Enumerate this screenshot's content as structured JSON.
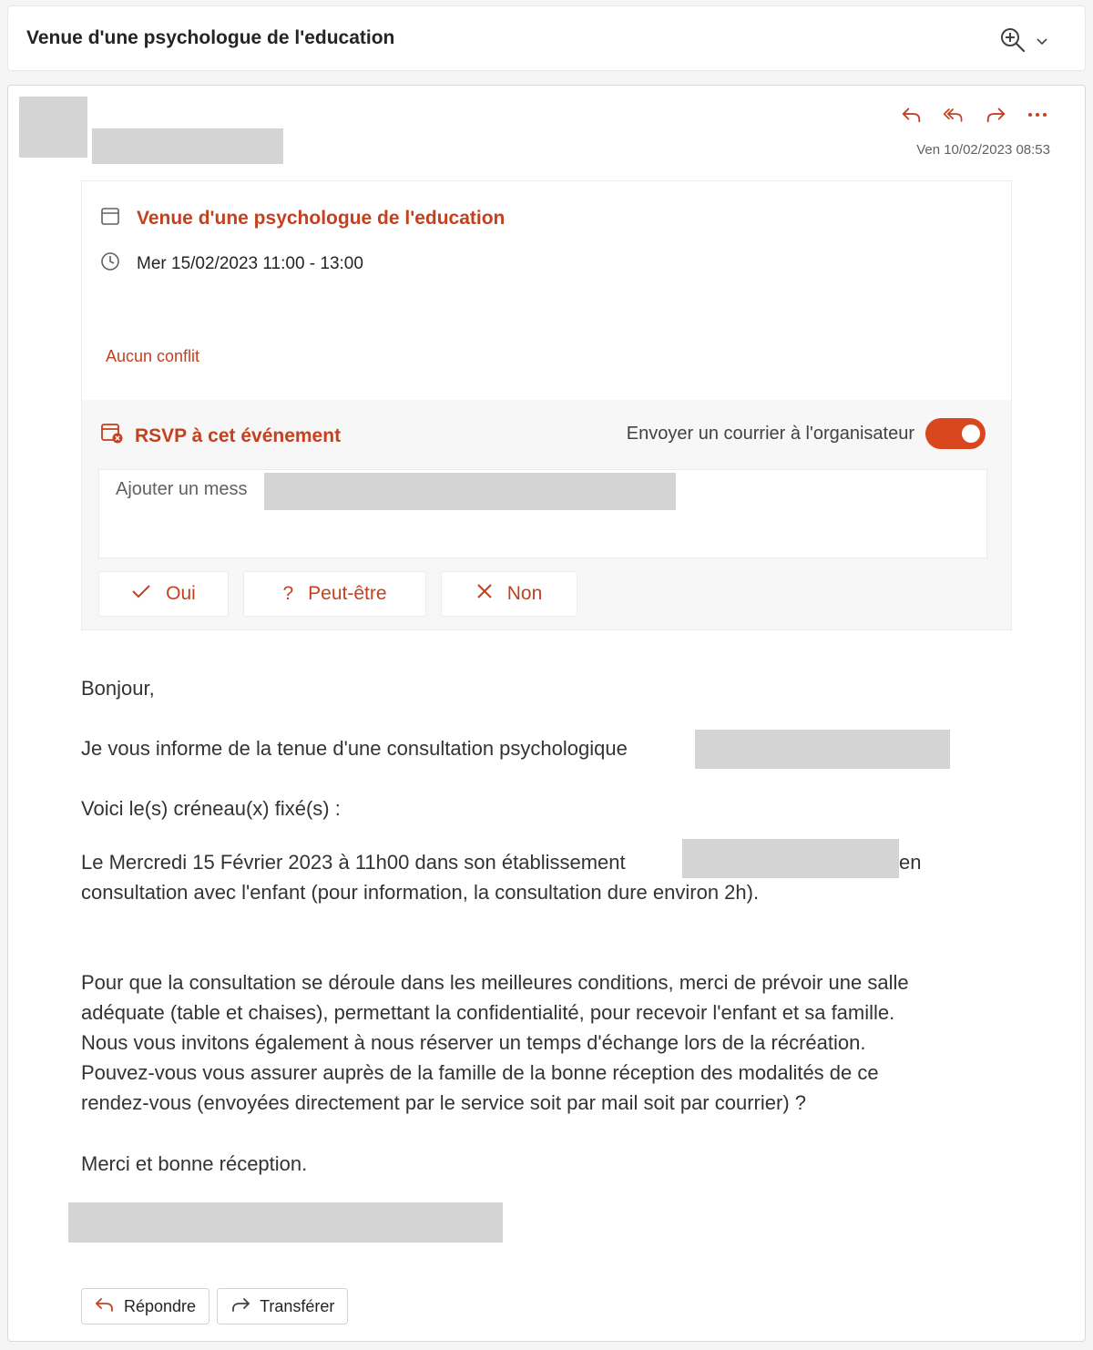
{
  "header": {
    "subject": "Venue d'une psychologue de l'education"
  },
  "message": {
    "sent_date": "Ven 10/02/2023 08:53"
  },
  "invite": {
    "title": "Venue d'une psychologue de l'education",
    "time": "Mer 15/02/2023 11:00 - 13:00",
    "conflict": "Aucun conflit"
  },
  "rsvp": {
    "label": "RSVP à cet événement",
    "send_mail_label": "Envoyer un courrier à l'organisateur",
    "send_mail_on": true,
    "message_placeholder": "Ajouter un mess",
    "yes": "Oui",
    "maybe": "Peut-être",
    "no": "Non"
  },
  "body": {
    "greeting": "Bonjour,",
    "line1": "Je vous informe de la tenue d'une consultation psychologique",
    "line2": "Voici le(s) créneau(x) fixé(s) :",
    "line3_a": "Le Mercredi 15 Février 2023 à 11h00 dans son établissement",
    "line3_b": "en",
    "line3_c": "consultation avec l'enfant (pour information, la consultation dure environ 2h).",
    "para_1": "Pour que la consultation se déroule dans les meilleures conditions, merci de prévoir une salle",
    "para_2": "adéquate (table et chaises), permettant la confidentialité, pour recevoir l'enfant et sa famille.",
    "para_3": "Nous vous invitons également à nous réserver un temps d'échange lors de la récréation.",
    "para_4": "Pouvez-vous vous assurer auprès de la famille de la bonne réception des modalités de ce",
    "para_5": "rendez-vous (envoyées directement par le service soit par mail soit par courrier) ?",
    "closing": "Merci et bonne réception."
  },
  "footer": {
    "reply": "Répondre",
    "forward": "Transférer"
  },
  "colors": {
    "accent": "#c4401f",
    "toggle": "#d9471f",
    "redaction": "#d4d4d4"
  }
}
